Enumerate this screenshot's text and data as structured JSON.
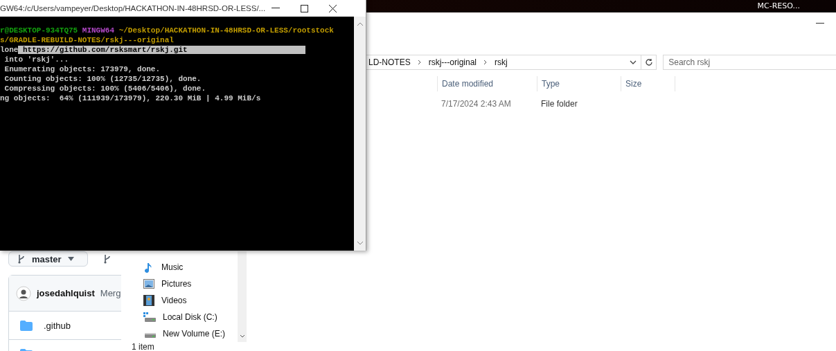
{
  "desktop": {
    "taskbar_label": "MC-RESO..."
  },
  "browser": {
    "branch": "master",
    "author": "josedahlquist",
    "commit_message": "Merg",
    "files": [
      {
        "name": ".github"
      }
    ]
  },
  "explorer": {
    "breadcrumb": [
      "LD-NOTES",
      "rskj---original",
      "rskj"
    ],
    "search": {
      "placeholder": "Search rskj"
    },
    "columns": [
      "Date modified",
      "Type",
      "Size"
    ],
    "rows": [
      {
        "date_modified": "7/17/2024 2:43 AM",
        "type": "File folder"
      }
    ],
    "sidebar": [
      {
        "label": "Music",
        "kind": "music"
      },
      {
        "label": "Pictures",
        "kind": "pictures"
      },
      {
        "label": "Videos",
        "kind": "videos"
      },
      {
        "label": "Local Disk (C:)",
        "kind": "system-disk"
      },
      {
        "label": "New Volume (E:)",
        "kind": "disk"
      }
    ],
    "status": "1 item"
  },
  "terminal": {
    "title": "GW64:/c/Users/vampeyer/Desktop/HACKATHON-IN-48HRSD-OR-LESS/...",
    "lines": [
      [
        {
          "text": "r@DESKTOP-934TQ75",
          "color": "#13a10e"
        },
        {
          "text": " MINGW64",
          "color": "#b148c6"
        },
        {
          "text": " ~/Desktop/HACKATHON-IN-48HRSD-OR-LESS/rootstock",
          "color": "#c19c00"
        }
      ],
      [
        {
          "text": "s/GRADLE-REBUILD-NOTES/rskj---original",
          "color": "#c19c00"
        }
      ],
      [
        {
          "text": "lone",
          "color": "#cccccc"
        },
        {
          "text": " https://github.com/rsksmart/rskj.git",
          "color": "#000000",
          "selected": true
        }
      ],
      [
        {
          "text": " into 'rskj'...",
          "color": "#cccccc"
        }
      ],
      [
        {
          "text": " Enumerating objects: 173979, done.",
          "color": "#cccccc"
        }
      ],
      [
        {
          "text": " Counting objects: 100% (12735/12735), done.",
          "color": "#cccccc"
        }
      ],
      [
        {
          "text": " Compressing objects: 100% (5406/5406), done.",
          "color": "#cccccc"
        }
      ],
      [
        {
          "text": "ng objects:  64% (111939/173979), 220.30 MiB | 4.99 MiB/s",
          "color": "#cccccc"
        }
      ]
    ]
  }
}
